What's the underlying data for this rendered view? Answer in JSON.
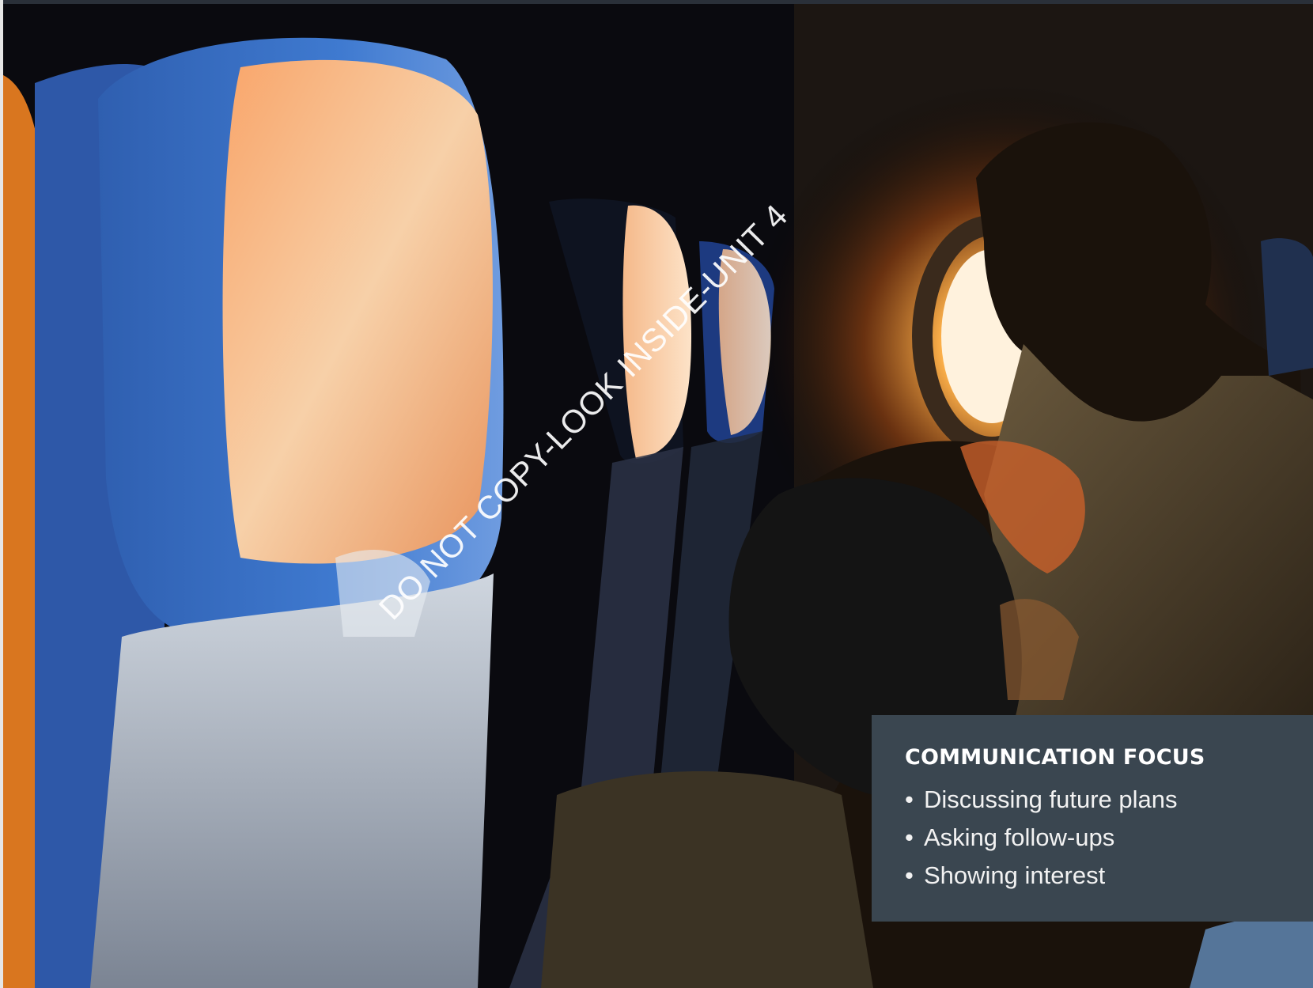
{
  "photo": {
    "subject": "airplane-cabin-photo"
  },
  "watermark": {
    "text": "DO NOT COPY-LOOK INSIDE-UNIT 4"
  },
  "communication_focus": {
    "title": "COMMUNICATION FOCUS",
    "bullet_glyph": "•",
    "items": [
      "Discussing future plans",
      "Asking follow-ups",
      "Showing interest"
    ]
  },
  "colors": {
    "panel": "#3a4650",
    "panel_text": "#ffffff",
    "top_border": "#2a3039"
  }
}
